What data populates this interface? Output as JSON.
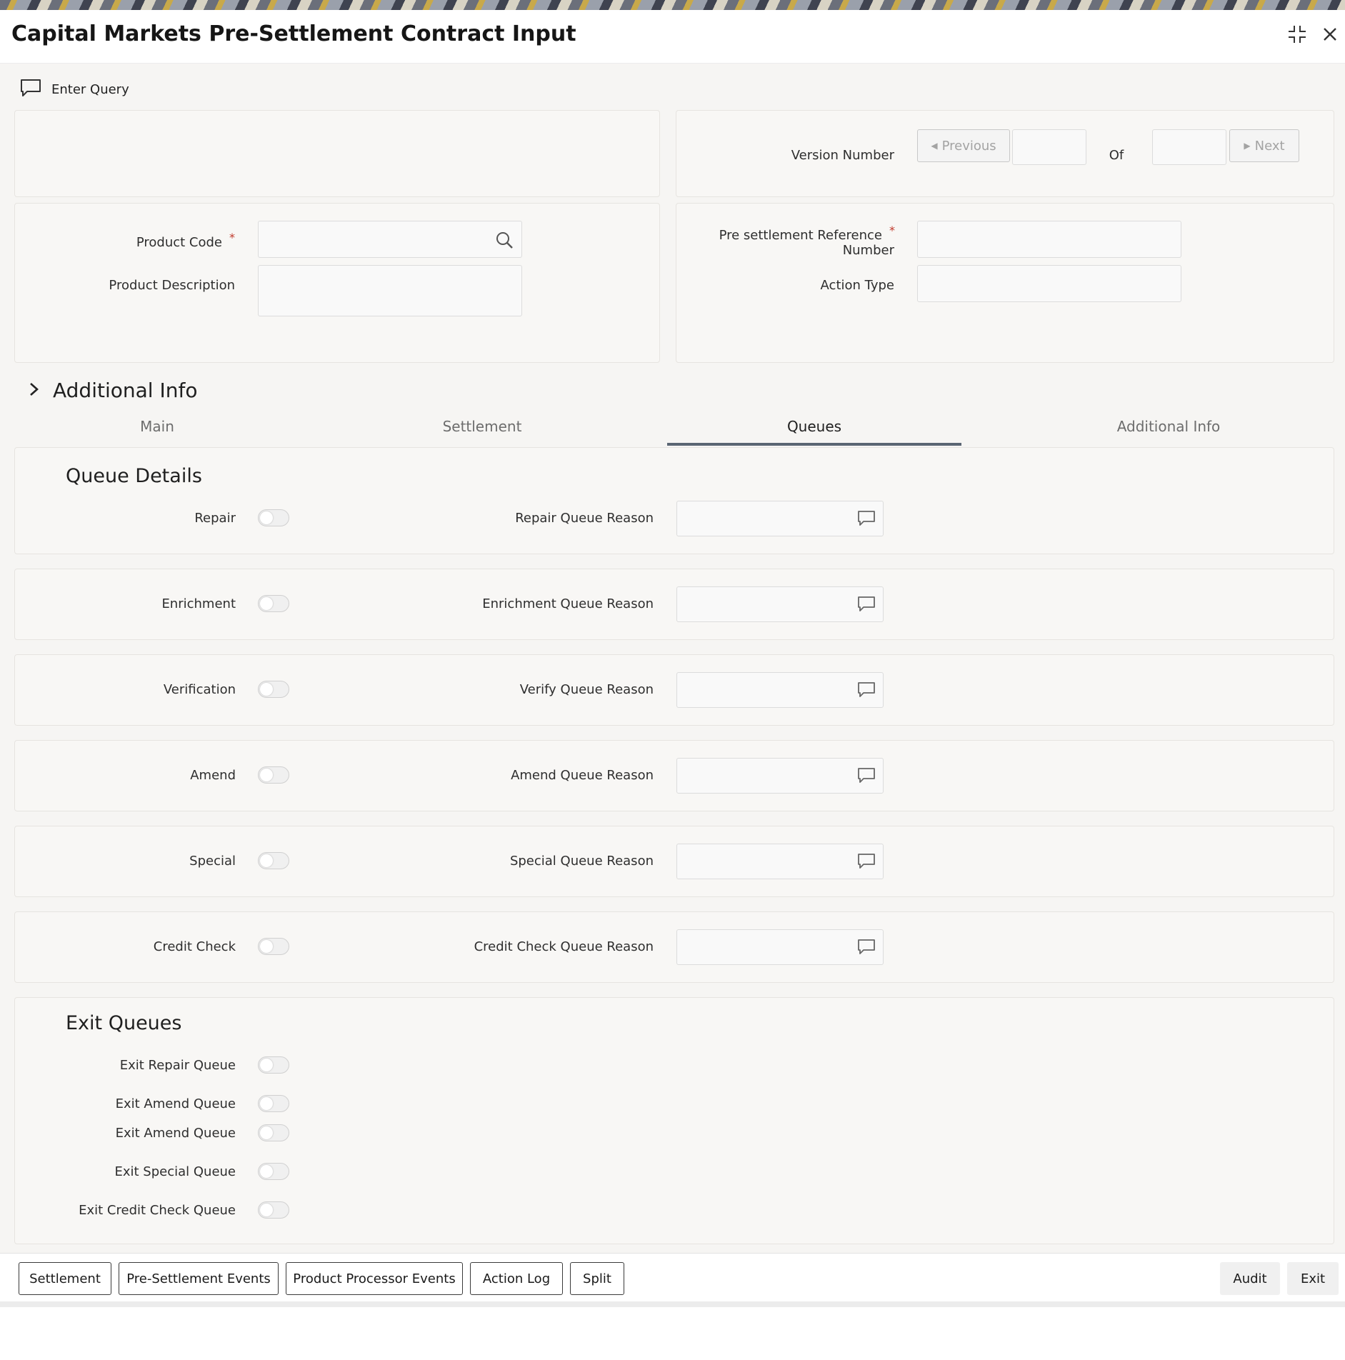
{
  "window": {
    "title": "Capital Markets Pre-Settlement Contract Input"
  },
  "toolbar": {
    "enter_query": "Enter Query"
  },
  "version": {
    "label": "Version Number",
    "previous": "Previous",
    "of": "Of",
    "next": "Next"
  },
  "fields": {
    "product_code": "Product Code",
    "product_description": "Product Description",
    "ref_line1": "Pre settlement Reference",
    "ref_line2": "Number",
    "action_type": "Action Type",
    "required_mark": "*"
  },
  "additional_info_header": "Additional Info",
  "tabs": [
    {
      "label": "Main",
      "active": false
    },
    {
      "label": "Settlement",
      "active": false
    },
    {
      "label": "Queues",
      "active": true
    },
    {
      "label": "Additional Info",
      "active": false
    }
  ],
  "queue_details": {
    "heading": "Queue Details",
    "rows": [
      {
        "label": "Repair",
        "reason_label": "Repair Queue Reason"
      },
      {
        "label": "Enrichment",
        "reason_label": "Enrichment Queue Reason"
      },
      {
        "label": "Verification",
        "reason_label": "Verify Queue Reason"
      },
      {
        "label": "Amend",
        "reason_label": "Amend Queue Reason"
      },
      {
        "label": "Special",
        "reason_label": "Special Queue Reason"
      },
      {
        "label": "Credit Check",
        "reason_label": "Credit Check Queue Reason"
      }
    ]
  },
  "exit_queues": {
    "heading": "Exit Queues",
    "items": [
      "Exit Repair Queue",
      "Exit Amend Queue",
      "Exit Amend Queue",
      "Exit Special Queue",
      "Exit Credit Check Queue"
    ]
  },
  "footer": {
    "buttons": [
      "Settlement",
      "Pre-Settlement Events",
      "Product Processor Events",
      "Action Log",
      "Split"
    ],
    "audit": "Audit",
    "exit": "Exit"
  },
  "icons": {
    "expand": "expand-icon",
    "close": "close-icon",
    "query": "speech-bubble-icon",
    "search": "search-icon",
    "chevron": "chevron-right-icon",
    "comment": "comment-icon"
  }
}
